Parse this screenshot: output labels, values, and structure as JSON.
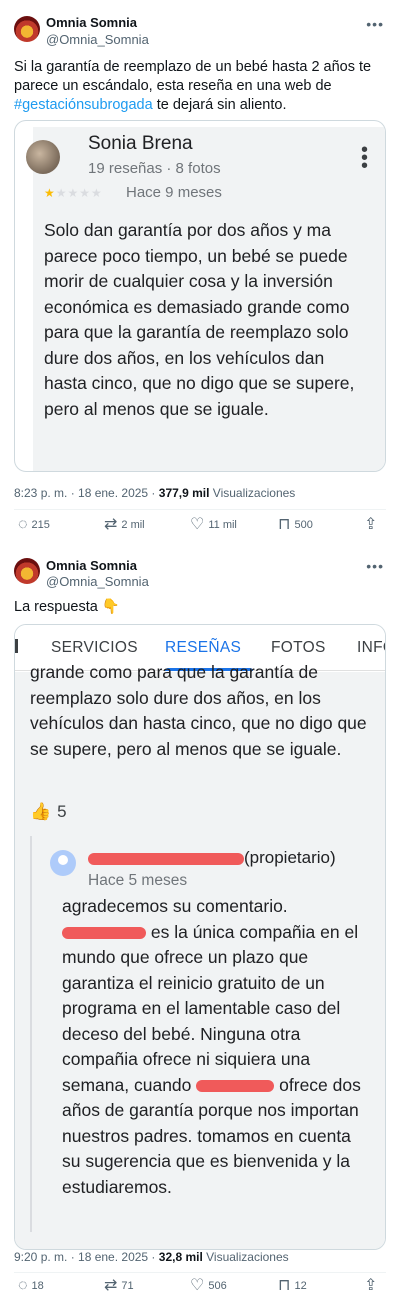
{
  "tweet1": {
    "author_name": "Omnia Somnia",
    "author_handle": "@Omnia_Somnia",
    "more_icon": "ellipsis-icon",
    "text_before": "Si la garantía de reemplazo de un bebé hasta 2 años te parece un escándalo, esta reseña en una web de ",
    "hashtag": "#gestaciónsubrogada",
    "text_after": " te dejará sin aliento.",
    "review": {
      "reviewer_name": "Sonia Brena",
      "reviewer_meta": "19 reseñas · 8 fotos",
      "rating": 1,
      "rating_max": 5,
      "time": "Hace 9 meses",
      "body": "Solo dan garantía por dos años y ma parece poco tiempo, un bebé se puede morir de cualquier cosa y la inversión económica es demasiado grande como para que la garantía de reemplazo solo dure dos años, en los vehículos dan hasta cinco, que no digo que se supere, pero al menos que se iguale."
    },
    "time": "8:23 p. m. · 18 ene. 2025 · ",
    "views_count": "377,9 mil",
    "views_label": " Visualizaciones",
    "actions": {
      "replies": "215",
      "reposts": "2 mil",
      "likes": "11 mil",
      "bookmarks": "500"
    }
  },
  "tweet2": {
    "author_name": "Omnia Somnia",
    "author_handle": "@Omnia_Somnia",
    "text": "La respuesta 👇",
    "tabs": [
      "SERVICIOS",
      "RESEÑAS",
      "FOTOS",
      "INFO"
    ],
    "active_tab": "RESEÑAS",
    "review_tail": "grande como para que la garantía de reemplazo solo dure dos años, en los vehículos dan hasta cinco, que no digo que se supere, pero al menos que se iguale.",
    "helpful_count": "5",
    "owner_suffix": "(propietario)",
    "owner_time": "Hace 5 meses",
    "owner_line1": "agradecemos su comentario.",
    "owner_line2": "es la única compañia en el mundo que ofrece un plazo que garantiza el reinicio gratuito de un programa en el lamentable caso del deceso del bebé. Ninguna otra compañia ofrece ni siquiera una semana, cuando",
    "owner_line3": "ofrece dos años de garantía porque nos importan nuestros padres. tomamos en cuenta su sugerencia que es bienvenida y la estudiaremos.",
    "time": "9:20 p. m. · 18 ene. 2025 · ",
    "views_count": "32,8 mil",
    "views_label": " Visualizaciones",
    "actions": {
      "replies": "18",
      "reposts": "71",
      "likes": "506",
      "bookmarks": "12"
    }
  },
  "colors": {
    "accent": "#1d9bf0",
    "google_blue": "#1a73e8",
    "redaction": "#f05a5a",
    "star": "#fbbc04"
  }
}
